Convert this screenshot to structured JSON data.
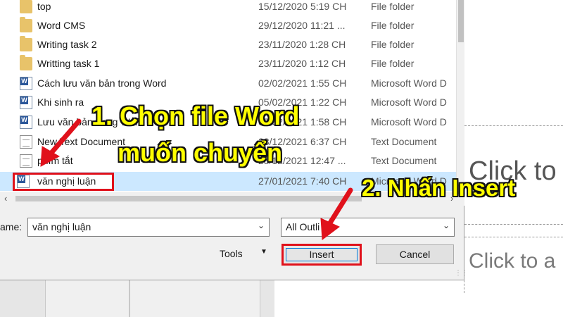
{
  "files": [
    {
      "name": "top",
      "date": "15/12/2020 5:19 CH",
      "type": "File folder",
      "icon": "folder-icon"
    },
    {
      "name": "Word CMS",
      "date": "29/12/2020 11:21 ...",
      "type": "File folder",
      "icon": "folder-icon"
    },
    {
      "name": "Writing task 2",
      "date": "23/11/2020 1:28 CH",
      "type": "File folder",
      "icon": "folder-icon"
    },
    {
      "name": "Writting task 1",
      "date": "23/11/2020 1:12 CH",
      "type": "File folder",
      "icon": "folder-icon"
    },
    {
      "name": "Cách lưu văn bản trong Word",
      "date": "02/02/2021 1:55 CH",
      "type": "Microsoft Word D",
      "icon": "word-doc-icon"
    },
    {
      "name": "Khi sinh ra",
      "date": "05/02/2021 1:22 CH",
      "type": "Microsoft Word D",
      "icon": "word-doc-icon"
    },
    {
      "name": "Lưu văn bản trong Word",
      "date": "05/02/2021 1:58 CH",
      "type": "Microsoft Word D",
      "icon": "word-doc-icon"
    },
    {
      "name": "New Text Document",
      "date": "28/12/2021 6:37 CH",
      "type": "Text Document",
      "icon": "text-doc-icon"
    },
    {
      "name": "phím tắt",
      "date": "28/12/2021 12:47 ...",
      "type": "Text Document",
      "icon": "text-doc-icon"
    },
    {
      "name": "văn nghị luận",
      "date": "27/01/2021 7:40 CH",
      "type": "Microsoft Word D",
      "icon": "word-doc-icon",
      "selected": true
    }
  ],
  "filename": {
    "label": "ame:",
    "value": "văn nghị luận"
  },
  "filter": {
    "value": "All Outli"
  },
  "tools_label": "Tools",
  "insert_label": "Insert",
  "cancel_label": "Cancel",
  "background": {
    "placeholder_title": "Click to",
    "placeholder_text": "Click to a"
  },
  "annotations": {
    "step1_line1": "1. Chọn file Word",
    "step1_line2": "muốn chuyển",
    "step2": "2. Nhấn Insert",
    "text_color": "#ffff00",
    "highlight_color": "#e0111b"
  }
}
